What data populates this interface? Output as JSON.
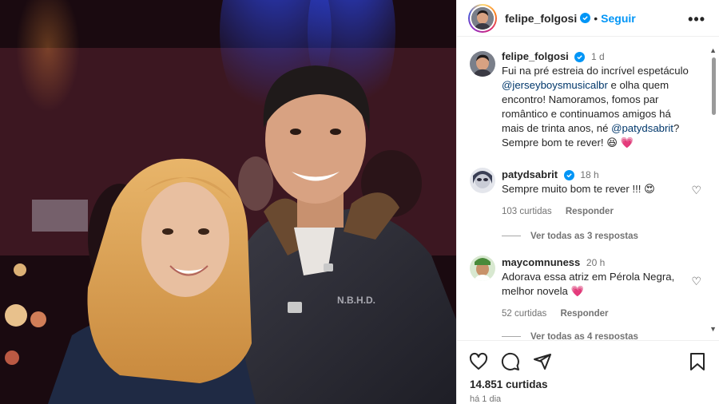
{
  "post": {
    "username": "felipe_folgosi",
    "follow_label": "Seguir",
    "separator": "•"
  },
  "caption": {
    "username": "felipe_folgosi",
    "time": "1 d",
    "text_1": "Fui na pré estreia do incrível espetáculo",
    "mention_1": "@jerseyboysmusicalbr",
    "text_2": " e olha quem encontro! Namoramos, fomos par romântico e continuamos amigos há mais de trinta anos, né ",
    "mention_2": "@patydsabrit",
    "text_3": "? Sempre bom te rever! 😆 💗"
  },
  "comments": [
    {
      "username": "patydsabrit",
      "time": "18 h",
      "text": "Sempre muito bom te rever !!! 😍",
      "likes": "103 curtidas",
      "reply_label": "Responder",
      "view_replies": "Ver todas as 3 respostas"
    },
    {
      "username": "maycomnuness",
      "time": "20 h",
      "text": "Adorava essa atriz em Pérola Negra, melhor novela 💗",
      "likes": "52 curtidas",
      "reply_label": "Responder",
      "view_replies": "Ver todas as 4 respostas"
    }
  ],
  "footer": {
    "likes": "14.851 curtidas",
    "posted": "há 1 dia"
  },
  "jacket_text": "N.B.H.D.",
  "icons": [
    "verified-icon",
    "more-icon",
    "heart-icon",
    "comment-icon",
    "share-icon",
    "bookmark-icon"
  ],
  "colors": {
    "accent": "#0095f6",
    "mention": "#00376b",
    "muted": "#737373",
    "heart_red": "#e0245e"
  }
}
